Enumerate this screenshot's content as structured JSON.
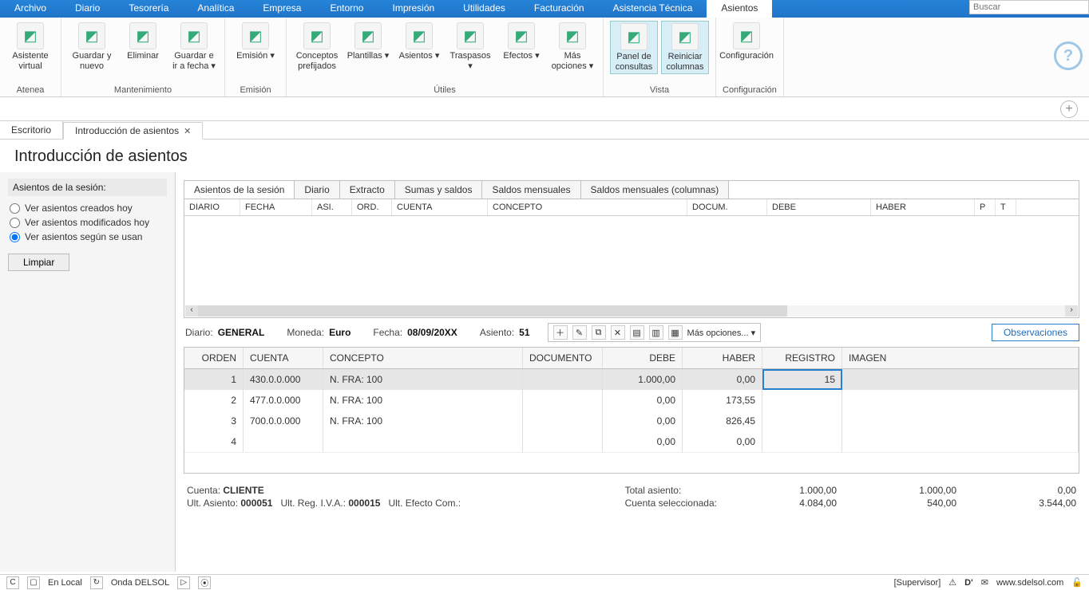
{
  "menu": [
    "Archivo",
    "Diario",
    "Tesorería",
    "Analítica",
    "Empresa",
    "Entorno",
    "Impresión",
    "Utilidades",
    "Facturación",
    "Asistencia Técnica",
    "Asientos"
  ],
  "menu_active_index": 10,
  "search_placeholder": "Buscar",
  "ribbon": {
    "groups": [
      {
        "label": "Atenea",
        "buttons": [
          {
            "label": "Asistente virtual",
            "name": "asistente-virtual"
          }
        ]
      },
      {
        "label": "Mantenimiento",
        "buttons": [
          {
            "label": "Guardar y nuevo",
            "name": "guardar-nuevo"
          },
          {
            "label": "Eliminar",
            "name": "eliminar"
          },
          {
            "label": "Guardar e ir a fecha ▾",
            "name": "guardar-ir-fecha"
          }
        ]
      },
      {
        "label": "Emisión",
        "buttons": [
          {
            "label": "Emisión ▾",
            "name": "emision"
          }
        ]
      },
      {
        "label": "Útiles",
        "buttons": [
          {
            "label": "Conceptos prefijados",
            "name": "conceptos-prefijados"
          },
          {
            "label": "Plantillas ▾",
            "name": "plantillas"
          },
          {
            "label": "Asientos ▾",
            "name": "asientos-util"
          },
          {
            "label": "Traspasos ▾",
            "name": "traspasos"
          },
          {
            "label": "Efectos ▾",
            "name": "efectos"
          },
          {
            "label": "Más opciones ▾",
            "name": "mas-opciones-utiles"
          }
        ]
      },
      {
        "label": "Vista",
        "buttons": [
          {
            "label": "Panel de consultas",
            "name": "panel-consultas",
            "highlight": true
          },
          {
            "label": "Reiniciar columnas",
            "name": "reiniciar-columnas",
            "highlight": true
          }
        ]
      },
      {
        "label": "Configuración",
        "buttons": [
          {
            "label": "Configuración",
            "name": "configuracion"
          }
        ]
      }
    ]
  },
  "doc_tabs": [
    {
      "label": "Escritorio",
      "active": false,
      "closable": false
    },
    {
      "label": "Introducción de asientos",
      "active": true,
      "closable": true
    }
  ],
  "page_title": "Introducción de asientos",
  "side": {
    "title": "Asientos de la sesión:",
    "radios": [
      {
        "label": "Ver asientos creados hoy",
        "checked": false
      },
      {
        "label": "Ver asientos modificados hoy",
        "checked": false
      },
      {
        "label": "Ver asientos según se usan",
        "checked": true
      }
    ],
    "clear_label": "Limpiar"
  },
  "inner_tabs": [
    "Asientos de la sesión",
    "Diario",
    "Extracto",
    "Sumas y saldos",
    "Saldos mensuales",
    "Saldos mensuales (columnas)"
  ],
  "inner_tab_active": 0,
  "grid1_headers": [
    "DIARIO",
    "FECHA",
    "ASI.",
    "ORD.",
    "CUENTA",
    "CONCEPTO",
    "DOCUM.",
    "DEBE",
    "HABER",
    "P",
    "T"
  ],
  "info": {
    "diario_label": "Diario:",
    "diario": "GENERAL",
    "moneda_label": "Moneda:",
    "moneda": "Euro",
    "fecha_label": "Fecha:",
    "fecha": "08/09/20XX",
    "asiento_label": "Asiento:",
    "asiento": "51"
  },
  "toolbar2_more": "Más opciones... ▾",
  "observaciones_label": "Observaciones",
  "grid2_headers": [
    "ORDEN",
    "CUENTA",
    "CONCEPTO",
    "DOCUMENTO",
    "DEBE",
    "HABER",
    "REGISTRO",
    "IMAGEN"
  ],
  "grid2_rows": [
    {
      "orden": "1",
      "cuenta": "430.0.0.000",
      "concepto": "N. FRA:  100",
      "doc": "",
      "debe": "1.000,00",
      "haber": "0,00",
      "reg": "15",
      "sel": true
    },
    {
      "orden": "2",
      "cuenta": "477.0.0.000",
      "concepto": "N. FRA:  100",
      "doc": "",
      "debe": "0,00",
      "haber": "173,55",
      "reg": "",
      "sel": false
    },
    {
      "orden": "3",
      "cuenta": "700.0.0.000",
      "concepto": "N. FRA:  100",
      "doc": "",
      "debe": "0,00",
      "haber": "826,45",
      "reg": "",
      "sel": false
    },
    {
      "orden": "4",
      "cuenta": "",
      "concepto": "",
      "doc": "",
      "debe": "0,00",
      "haber": "0,00",
      "reg": "",
      "sel": false
    }
  ],
  "summary": {
    "cuenta_label": "Cuenta:",
    "cuenta": "CLIENTE",
    "ult_asiento_label": "Ult. Asiento:",
    "ult_asiento": "000051",
    "ult_reg_label": "Ult. Reg. I.V.A.:",
    "ult_reg": "000015",
    "ult_efecto_label": "Ult. Efecto Com.:",
    "ult_efecto": "",
    "total_label": "Total asiento:",
    "seleccionada_label": "Cuenta seleccionada:",
    "totals_row1": [
      "1.000,00",
      "1.000,00",
      "0,00"
    ],
    "totals_row2": [
      "4.084,00",
      "540,00",
      "3.544,00"
    ]
  },
  "status": {
    "local": "En Local",
    "product": "Onda DELSOL",
    "user": "[Supervisor]",
    "site": "www.sdelsol.com"
  }
}
